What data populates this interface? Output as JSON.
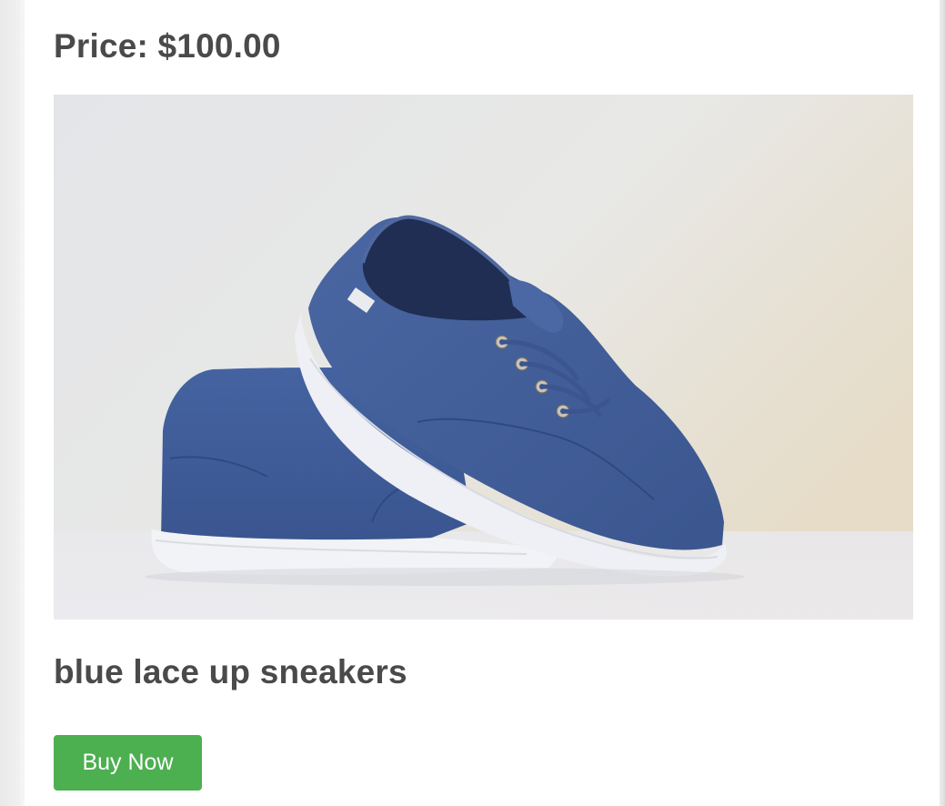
{
  "product": {
    "price_text": "Price: $100.00",
    "name": "blue lace up sneakers",
    "image_alt": "blue lace up sneakers",
    "buy_label": "Buy Now"
  },
  "colors": {
    "button": "#4caf50",
    "heading_text": "#4a4a4a",
    "shoe": "#3d5a92"
  }
}
